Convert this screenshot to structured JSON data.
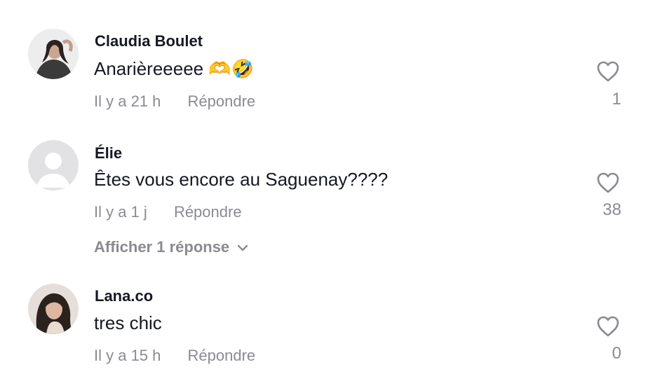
{
  "comments": [
    {
      "username": "Claudia Boulet",
      "text": "Anarièreeeee 🫶🤣",
      "time": "Il y a 21 h",
      "reply_label": "Répondre",
      "likes": "1"
    },
    {
      "username": "Élie",
      "text": "Êtes vous encore au Saguenay????",
      "time": "Il y a 1 j",
      "reply_label": "Répondre",
      "likes": "38",
      "view_replies_label": "Afficher 1 réponse"
    },
    {
      "username": "Lana.co",
      "text": "tres chic",
      "time": "Il y a 15 h",
      "reply_label": "Répondre",
      "likes": "0"
    }
  ],
  "colors": {
    "primary_text": "#161823",
    "secondary_text": "#8a8b91",
    "background": "#ffffff"
  },
  "icons": [
    "heart-outline-icon",
    "chevron-down-icon",
    "default-avatar-icon"
  ]
}
